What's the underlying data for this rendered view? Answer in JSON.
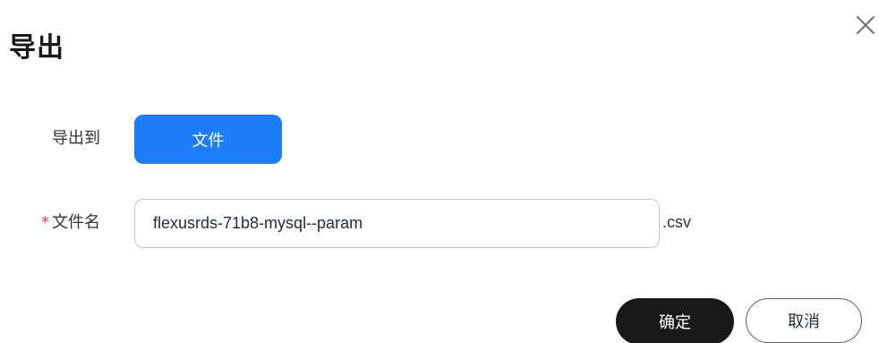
{
  "dialog": {
    "title": "导出",
    "close_icon": "close-icon"
  },
  "form": {
    "export_to": {
      "label": "导出到",
      "option_label": "文件"
    },
    "filename": {
      "required_mark": "*",
      "label": "文件名",
      "value": "flexusrds-71b8-mysql--param",
      "extension": ".csv"
    }
  },
  "footer": {
    "confirm_label": "确定",
    "cancel_label": "取消"
  },
  "colors": {
    "primary": "#1d7dfb",
    "confirm_bg": "#191919",
    "required": "#e54545"
  }
}
